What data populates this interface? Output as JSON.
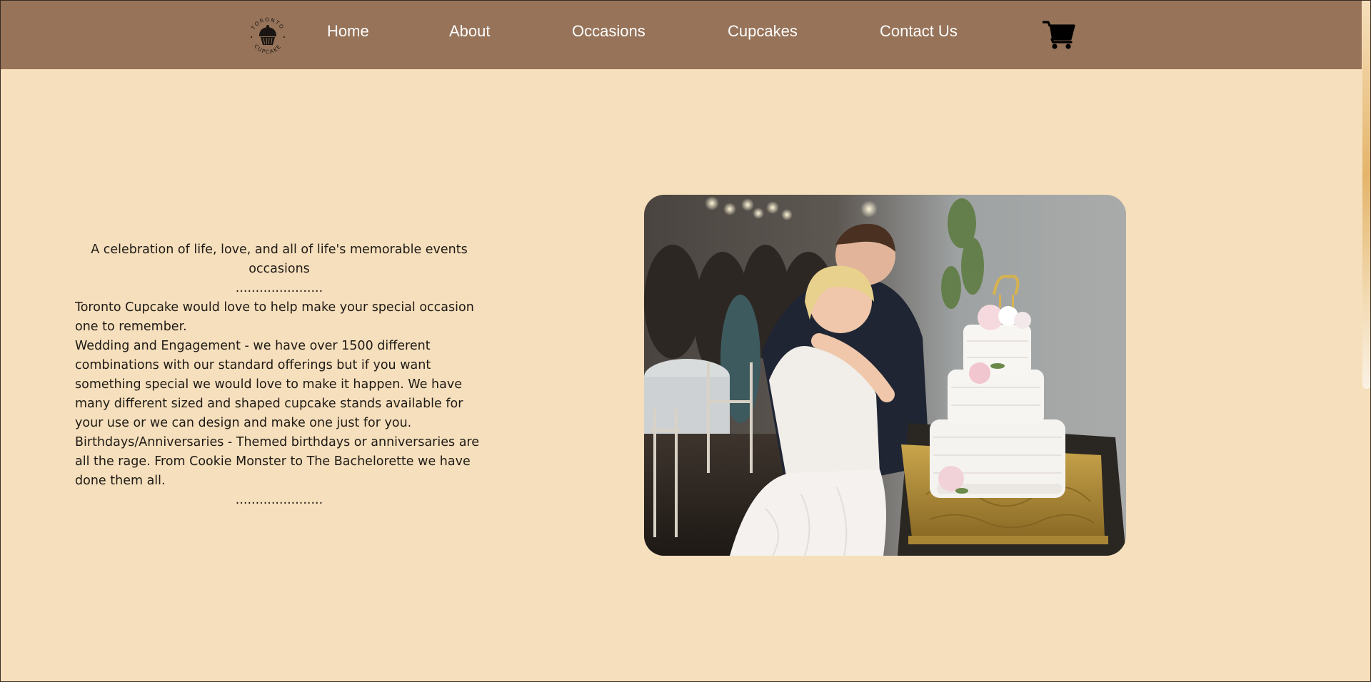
{
  "nav": {
    "logo_top_text": "TORONTO",
    "logo_bottom_text": "CUPCAKE",
    "links": [
      "Home",
      "About",
      "Occasions",
      "Cupcakes",
      "Contact Us"
    ],
    "cart_icon": "shopping-cart-icon"
  },
  "main": {
    "heading_line": "A celebration of life, love, and all of life's memorable events",
    "heading_sub": "occasions",
    "divider": "......................",
    "intro": "Toronto Cupcake would love to help make your special occasion one to remember.",
    "wedding": "Wedding and Engagement - we have over 1500 different combinations with our standard offerings but if you want something special we would love to make it happen. We have many different sized and shaped cupcake stands available for your use or we can design and make one just for you.",
    "birthdays": "Birthdays/Anniversaries - Themed birthdays or anniversaries are all the rage. From Cookie Monster to The Bachelorette we have done them all.",
    "photo_icon": "wedding-cake-photo"
  },
  "colors": {
    "nav_bg": "#967359",
    "page_bg": "#f6dfbc",
    "text": "#1e1a16"
  }
}
